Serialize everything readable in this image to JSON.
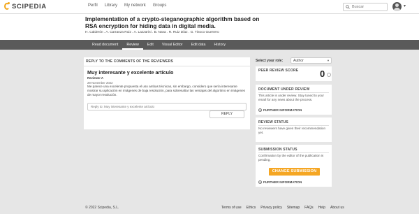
{
  "brand": {
    "name": "SCIPEDIA"
  },
  "nav": {
    "links": [
      "Perfil",
      "Library",
      "My network",
      "Groups"
    ]
  },
  "search": {
    "placeholder": "Buscar"
  },
  "document": {
    "title": "Implementation of a crypto-steganographic algorithm based on RSA encryption for hiding data in digital media.",
    "authors": "H. Calderón . A. Carranza Ruiz . A. Lazzarini . B. Nava . R. Ruiz Díaz . G. Tinoco Guerrero"
  },
  "tabs": [
    "Read document",
    "Review",
    "Edit",
    "Visual Editor",
    "Edit data",
    "History"
  ],
  "reply": {
    "section_title": "REPLY TO THE COMMENTS OF THE REVIEWERS",
    "comment_title": "Muy interesante y excelente artículo",
    "author": "Reviewer A",
    "date": "28 November 2022",
    "body": "Me parece una excelente propuesta el uso ambas técnicas, sin embargo, considero que sería interesante mostrar su aplicación en imágenes de baja resolución, para sobresaltar las ventajas del algoritmo en imágenes de mayor resolución.",
    "input_value": "Reply to: Muy interesante y excelente artículo",
    "button": "REPLY"
  },
  "sidebar": {
    "role_label": "Select your role:",
    "role_value": "Author",
    "peer_review": {
      "title": "PEER REVIEW SCORE",
      "score": "0"
    },
    "doc_review": {
      "title": "DOCUMENT UNDER REVIEW",
      "text": "This article is under review. Stay tuned to your email for any news about the process.",
      "link": "FURTHER INFORMATION"
    },
    "review_status": {
      "title": "REVIEW STATUS",
      "text": "No reviewers have given their recommendation yet."
    },
    "submission": {
      "title": "SUBMISSION STATUS",
      "text": "Confirmation by the editor of the publication is pending.",
      "button": "CHANGE SUBMISSION",
      "link": "FURTHER INFORMATION"
    }
  },
  "footer": {
    "copyright": "© 2022 Scipedia, S.L.",
    "links": [
      "Terms of use",
      "Ethics",
      "Privacy policy",
      "Sitemap",
      "FAQs",
      "Help",
      "About us"
    ]
  },
  "colors": {
    "accent": "#f5a623",
    "tabbar": "#5a5a5a",
    "background": "#e6e6e6"
  }
}
